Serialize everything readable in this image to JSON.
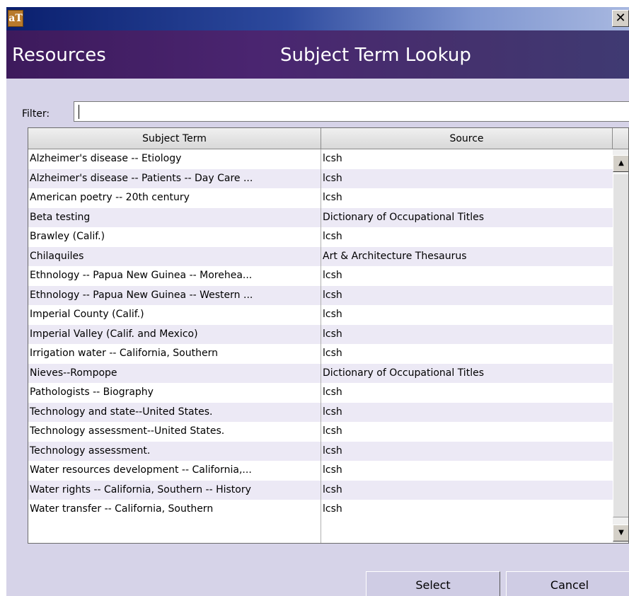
{
  "titlebar": {
    "icon_text": "aT",
    "close_glyph": "✕"
  },
  "header": {
    "left_title": "Resources",
    "right_title": "Subject Term Lookup"
  },
  "filter": {
    "label": "Filter:",
    "value": ""
  },
  "table": {
    "columns": [
      "Subject Term",
      "Source"
    ],
    "rows": [
      [
        "Alzheimer's disease -- Etiology",
        "lcsh"
      ],
      [
        "Alzheimer's disease -- Patients -- Day Care ...",
        "lcsh"
      ],
      [
        "American poetry -- 20th century",
        "lcsh"
      ],
      [
        "Beta testing",
        "Dictionary of Occupational Titles"
      ],
      [
        "Brawley (Calif.)",
        "lcsh"
      ],
      [
        "Chilaquiles",
        "Art & Architecture Thesaurus"
      ],
      [
        "Ethnology -- Papua New Guinea -- Morehea...",
        "lcsh"
      ],
      [
        "Ethnology -- Papua New Guinea -- Western ...",
        "lcsh"
      ],
      [
        "Imperial County (Calif.)",
        "lcsh"
      ],
      [
        "Imperial Valley (Calif. and Mexico)",
        "lcsh"
      ],
      [
        "Irrigation water -- California, Southern",
        "lcsh"
      ],
      [
        "Nieves--Rompope",
        "Dictionary of Occupational Titles"
      ],
      [
        "Pathologists -- Biography",
        "lcsh"
      ],
      [
        "Technology and state--United States.",
        "lcsh"
      ],
      [
        "Technology assessment--United States.",
        "lcsh"
      ],
      [
        "Technology assessment.",
        "lcsh"
      ],
      [
        "Water resources development -- California,...",
        "lcsh"
      ],
      [
        "Water rights -- California, Southern -- History",
        "lcsh"
      ],
      [
        "Water transfer -- California, Southern",
        "lcsh"
      ]
    ]
  },
  "scrollbar": {
    "up_glyph": "▲",
    "down_glyph": "▼"
  },
  "buttons": {
    "select": "Select",
    "cancel": "Cancel"
  },
  "colors": {
    "header_purple": "#3d1a5c",
    "titlebar_blue": "#0a1f6e",
    "dialog_bg": "#d6d3e8"
  }
}
